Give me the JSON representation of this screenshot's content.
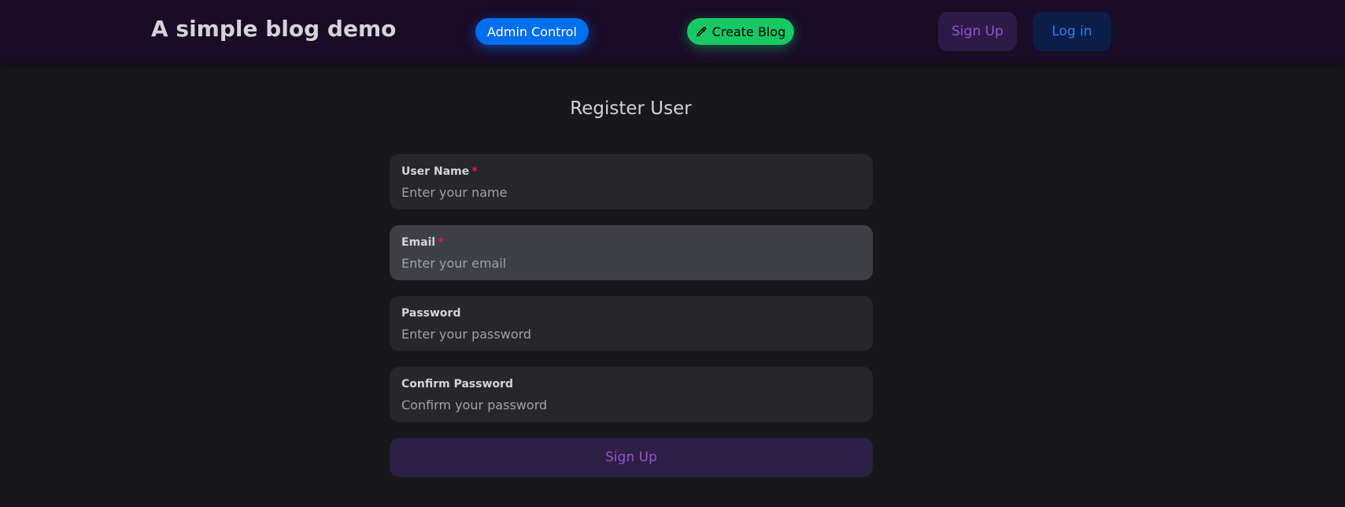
{
  "header": {
    "brand": "A simple blog demo",
    "admin_label": "Admin Control",
    "create_label": "Create Blog",
    "create_icon": "pencil-edit-icon",
    "signup_label": "Sign Up",
    "login_label": "Log in"
  },
  "form": {
    "title": "Register User",
    "required_mark": "*",
    "fields": {
      "username": {
        "label": "User Name",
        "placeholder": "Enter your name",
        "value": ""
      },
      "email": {
        "label": "Email",
        "placeholder": "Enter your email",
        "value": ""
      },
      "password": {
        "label": "Password",
        "placeholder": "Enter your password",
        "value": ""
      },
      "confirm": {
        "label": "Confirm Password",
        "placeholder": "Confirm your password",
        "value": ""
      }
    },
    "submit_label": "Sign Up"
  },
  "colors": {
    "background": "#18181b",
    "navbar": "#1a0b26",
    "primary": "#006fee",
    "success": "#17c964",
    "secondary": "#9353d3",
    "danger": "#f31260"
  }
}
